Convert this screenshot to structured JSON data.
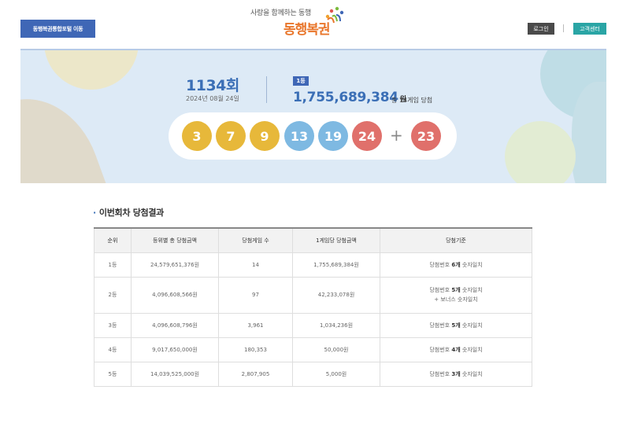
{
  "header": {
    "portal_button": "동행복권통합포털 이동",
    "logo_slogan": "사랑을 함께하는 동행",
    "logo_name": "동행복권",
    "login_button": "로그인",
    "cs_button": "고객센터"
  },
  "draw": {
    "round": "1134회",
    "date": "2024년 08월 24일",
    "rank_badge": "1등",
    "first_prize_amount": "1,755,689,384",
    "first_prize_unit": "원",
    "winner_count_text": "총 14게임 당첨",
    "plus": "+",
    "numbers": [
      {
        "value": "3",
        "color": "#e7b83a"
      },
      {
        "value": "7",
        "color": "#e7b83a"
      },
      {
        "value": "9",
        "color": "#e7b83a"
      },
      {
        "value": "13",
        "color": "#7eb9e2"
      },
      {
        "value": "19",
        "color": "#7eb9e2"
      },
      {
        "value": "24",
        "color": "#e0706b"
      }
    ],
    "bonus": {
      "value": "23",
      "color": "#e0706b"
    }
  },
  "results": {
    "title": "이번회차 당첨결과",
    "headers": [
      "순위",
      "등위별 총 당첨금액",
      "당첨게임 수",
      "1게임당 당첨금액",
      "당첨기준"
    ],
    "rows": [
      {
        "rank": "1등",
        "total": "24,579,651,376원",
        "games": "14",
        "per_game": "1,755,689,384원",
        "crit_pre": "당첨번호 ",
        "crit_bold": "6개",
        "crit_post": " 숫자일치",
        "crit_extra": ""
      },
      {
        "rank": "2등",
        "total": "4,096,608,566원",
        "games": "97",
        "per_game": "42,233,078원",
        "crit_pre": "당첨번호 ",
        "crit_bold": "5개",
        "crit_post": " 숫자일치",
        "crit_extra": "+ 보너스 숫자일치"
      },
      {
        "rank": "3등",
        "total": "4,096,608,796원",
        "games": "3,961",
        "per_game": "1,034,236원",
        "crit_pre": "당첨번호 ",
        "crit_bold": "5개",
        "crit_post": " 숫자일치",
        "crit_extra": ""
      },
      {
        "rank": "4등",
        "total": "9,017,650,000원",
        "games": "180,353",
        "per_game": "50,000원",
        "crit_pre": "당첨번호 ",
        "crit_bold": "4개",
        "crit_post": " 숫자일치",
        "crit_extra": ""
      },
      {
        "rank": "5등",
        "total": "14,039,525,000원",
        "games": "2,807,905",
        "per_game": "5,000원",
        "crit_pre": "당첨번호 ",
        "crit_bold": "3개",
        "crit_post": " 숫자일치",
        "crit_extra": ""
      }
    ]
  },
  "colors": {
    "primary": "#3f67b6",
    "accent_orange": "#e9762b",
    "teal": "#2aa5a5"
  }
}
